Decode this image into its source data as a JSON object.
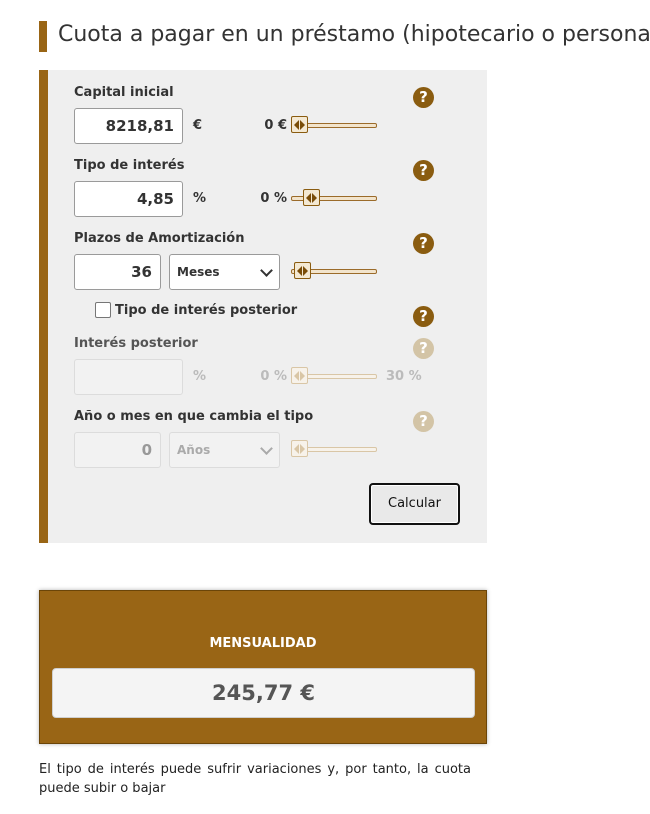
{
  "page": {
    "title": "Cuota a pagar en un préstamo (hipotecario o personal)"
  },
  "calculator": {
    "capital": {
      "label": "Capital inicial",
      "value": "8218,81",
      "unit": "€",
      "slider_min_label": "0 €",
      "slider_level": 0
    },
    "interest": {
      "label": "Tipo de interés",
      "value": "4,85",
      "unit": "%",
      "slider_min_label": "0 %",
      "slider_level": 0.17
    },
    "terms": {
      "label": "Plazos de Amortización",
      "value": "36",
      "period_selected": "Meses",
      "slider_level": 0.05
    },
    "later_rate_checkbox": {
      "label": "Tipo de interés posterior",
      "checked": false
    },
    "later_rate": {
      "label": "Interés posterior",
      "value": "",
      "unit": "%",
      "slider_min_label": "0 %",
      "slider_max_label": "30 %",
      "disabled": true,
      "slider_level": 0
    },
    "change_period": {
      "label": "Año o mes en que cambia el tipo",
      "value": "0",
      "period_selected": "Años",
      "disabled": true,
      "slider_level": 0
    },
    "help_symbol": "?",
    "calculate_label": "Calcular"
  },
  "result": {
    "title": "MENSUALIDAD",
    "value": "245,77 €"
  },
  "note": "El tipo de interés puede sufrir variaciones y, por tanto, la cuota puede subir o bajar",
  "colors": {
    "accent": "#996515",
    "panel_bg": "#efefef",
    "help_icon": "#8a5c10",
    "help_icon_disabled": "#d3c4a6"
  },
  "icons": {
    "help": "question-circle-icon",
    "slider_thumb": "double-arrow-icon",
    "select": "chevron-down-icon"
  }
}
